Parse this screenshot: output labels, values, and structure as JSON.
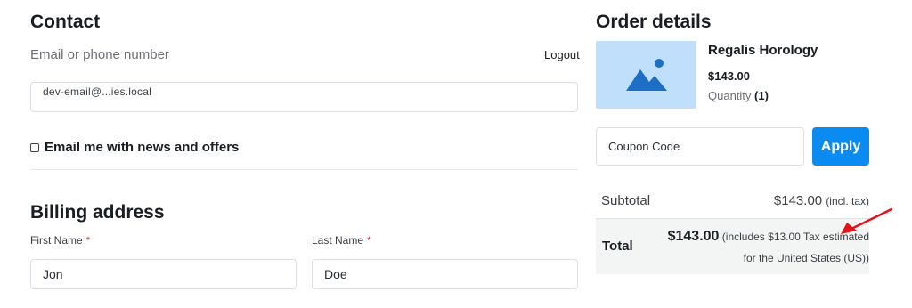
{
  "contact": {
    "title": "Contact",
    "email_label": "Email or phone number",
    "logout_label": "Logout",
    "email_value": "dev-email@...ies.local",
    "newsletter_label": "Email me with news and offers",
    "newsletter_checked": false
  },
  "billing": {
    "title": "Billing address",
    "first_name_label": "First Name",
    "last_name_label": "Last Name",
    "required_mark": "*",
    "first_name_value": "Jon",
    "last_name_value": "Doe"
  },
  "order": {
    "title": "Order details",
    "product": {
      "name": "Regalis Horology",
      "price": "$143.00",
      "quantity_label": "Quantity",
      "quantity_value": "(1)",
      "image_icon": "image-placeholder-icon"
    },
    "coupon": {
      "placeholder": "Coupon Code",
      "apply_label": "Apply"
    },
    "subtotal": {
      "label": "Subtotal",
      "amount": "$143.00",
      "note": "(incl. tax)"
    },
    "total": {
      "label": "Total",
      "amount": "$143.00",
      "note_line1": "(includes $13.00 Tax estimated",
      "note_line2": "for the United States (US))"
    }
  },
  "annotation": {
    "arrow_color": "#e3121b"
  },
  "colors": {
    "accent": "#0a8bf2",
    "thumbnail_bg": "#bfdffb",
    "thumbnail_icon": "#1c6fc4",
    "required": "#d63638"
  }
}
